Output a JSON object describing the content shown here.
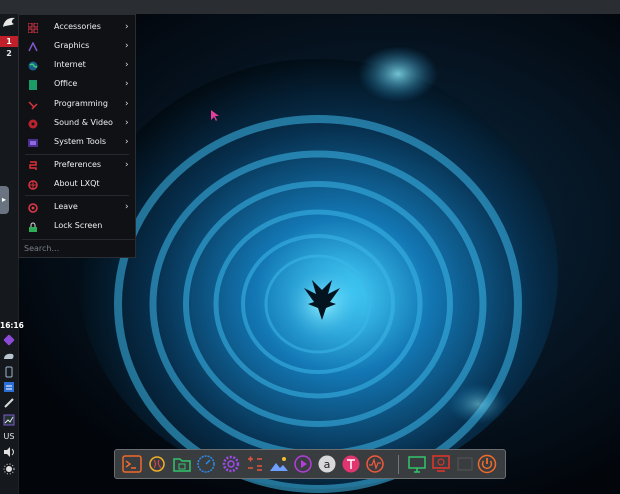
{
  "left_panel": {
    "workspaces": [
      "1",
      "2"
    ],
    "active_workspace": "1",
    "clock": "16:16",
    "keyboard_layout": "US"
  },
  "menu": {
    "items": [
      {
        "label": "Accessories",
        "icon": "accessories-icon",
        "submenu": true
      },
      {
        "label": "Graphics",
        "icon": "graphics-icon",
        "submenu": true
      },
      {
        "label": "Internet",
        "icon": "internet-icon",
        "submenu": true
      },
      {
        "label": "Office",
        "icon": "office-icon",
        "submenu": true
      },
      {
        "label": "Programming",
        "icon": "programming-icon",
        "submenu": true
      },
      {
        "label": "Sound & Video",
        "icon": "sound-video-icon",
        "submenu": true
      },
      {
        "label": "System Tools",
        "icon": "system-tools-icon",
        "submenu": true
      },
      {
        "label": "Preferences",
        "icon": "preferences-icon",
        "submenu": true
      },
      {
        "label": "About LXQt",
        "icon": "about-icon",
        "submenu": false
      },
      {
        "label": "Leave",
        "icon": "leave-icon",
        "submenu": true
      },
      {
        "label": "Lock Screen",
        "icon": "lock-screen-icon",
        "submenu": false
      }
    ],
    "search_placeholder": "Search..."
  },
  "dock": {
    "launchers": [
      "terminal-icon",
      "qbittorrent-icon",
      "file-manager-icon",
      "speedometer-icon",
      "settings-gear-icon",
      "calculator-icon",
      "image-viewer-icon",
      "media-player-icon",
      "amazon-icon",
      "font-viewer-icon",
      "system-monitor-icon",
      "display-settings-icon",
      "remote-desktop-icon",
      "power-icon"
    ]
  },
  "colors": {
    "accent_red": "#c0202a",
    "wallpaper_cyan": "#2bc4e8",
    "dock_orange": "#f06a2a",
    "dock_magenta": "#e0356f"
  }
}
